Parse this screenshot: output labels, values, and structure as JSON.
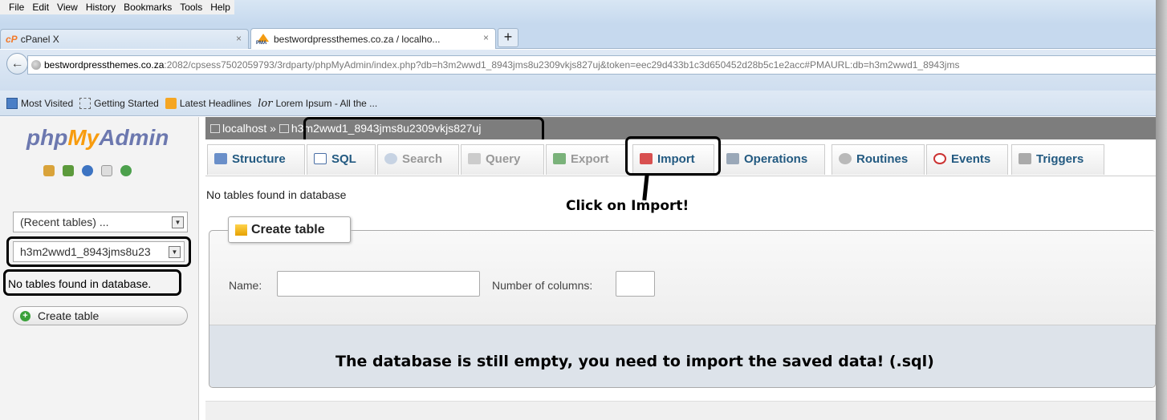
{
  "browser": {
    "menu": [
      "File",
      "Edit",
      "View",
      "History",
      "Bookmarks",
      "Tools",
      "Help"
    ],
    "tabs": [
      {
        "label": "cPanel X",
        "icon": "cpanel-icon"
      },
      {
        "label": "bestwordpressthemes.co.za / localho...",
        "icon": "phpmyadmin-icon"
      }
    ],
    "url_host": "bestwordpressthemes.co.za",
    "url_rest": ":2082/cpsess7502059793/3rdparty/phpMyAdmin/index.php?db=h3m2wwd1_8943jms8u2309vkjs827uj&token=eec29d433b1c3d650452d28b5c1e2acc#PMAURL:db=h3m2wwd1_8943jms",
    "bookmarks": [
      "Most Visited",
      "Getting Started",
      "Latest Headlines",
      "Lorem Ipsum - All the ..."
    ]
  },
  "sidebar": {
    "logo_php": "php",
    "logo_my": "My",
    "logo_admin": "Admin",
    "recent_tables": "(Recent tables) ...",
    "db_select": "h3m2wwd1_8943jms8u23",
    "no_tables": "No tables found in database.",
    "create_table": "Create table"
  },
  "main": {
    "breadcrumb_server": "localhost",
    "breadcrumb_sep": "»",
    "breadcrumb_db": "h3m2wwd1_8943jms8u2309vkjs827uj",
    "tabs": [
      "Structure",
      "SQL",
      "Search",
      "Query",
      "Export",
      "Import",
      "Operations",
      "Routines",
      "Events",
      "Triggers"
    ],
    "no_tables": "No tables found in database",
    "create_table_legend": "Create table",
    "name_label": "Name:",
    "columns_label": "Number of columns:"
  },
  "annotations": {
    "click_import": "Click on Import!",
    "empty_message": "The database is still empty, you need to import the saved data! (.sql)"
  }
}
